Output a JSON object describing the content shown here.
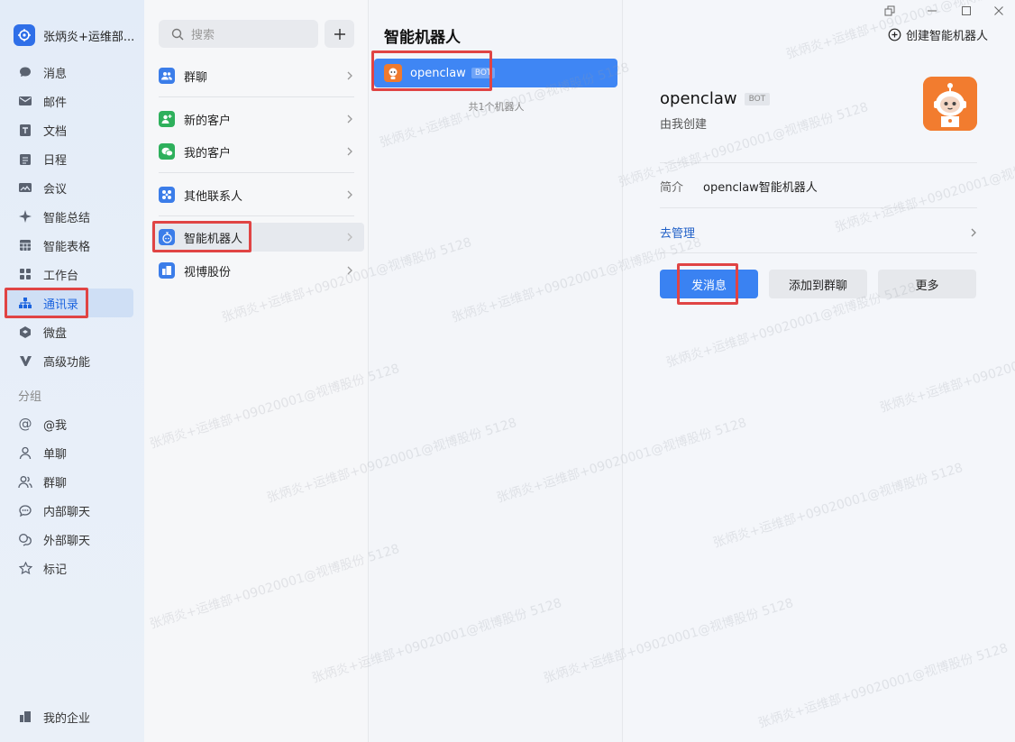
{
  "nav": {
    "enterprise_name": "张炳炎+运维部...",
    "items": [
      {
        "label": "消息",
        "icon": "chat-icon"
      },
      {
        "label": "邮件",
        "icon": "mail-icon"
      },
      {
        "label": "文档",
        "icon": "doc-icon"
      },
      {
        "label": "日程",
        "icon": "calendar-icon"
      },
      {
        "label": "会议",
        "icon": "meeting-icon"
      },
      {
        "label": "智能总结",
        "icon": "sparkle-icon"
      },
      {
        "label": "智能表格",
        "icon": "table-icon"
      },
      {
        "label": "工作台",
        "icon": "grid-icon"
      },
      {
        "label": "通讯录",
        "icon": "org-chart-icon",
        "active": true
      },
      {
        "label": "微盘",
        "icon": "drive-icon"
      },
      {
        "label": "高级功能",
        "icon": "v-icon"
      }
    ],
    "section_label": "分组",
    "groups": [
      {
        "label": "@我",
        "icon": "at-icon"
      },
      {
        "label": "单聊",
        "icon": "person-icon"
      },
      {
        "label": "群聊",
        "icon": "people-icon"
      },
      {
        "label": "内部聊天",
        "icon": "bubble-icon"
      },
      {
        "label": "外部聊天",
        "icon": "bubbles-icon"
      },
      {
        "label": "标记",
        "icon": "star-icon"
      }
    ],
    "bottom_label": "我的企业"
  },
  "contacts": {
    "search_placeholder": "搜索",
    "items": [
      {
        "label": "群聊",
        "color": "#3b7de9"
      },
      {
        "label": "新的客户",
        "color": "#2eb05c"
      },
      {
        "label": "我的客户",
        "color": "#2eb05c"
      },
      {
        "label": "其他联系人",
        "color": "#3b7de9"
      },
      {
        "label": "智能机器人",
        "color": "#3b7de9",
        "active": true
      },
      {
        "label": "视博股份",
        "color": "#3b7de9"
      }
    ]
  },
  "botlist": {
    "title": "智能机器人",
    "bot_name": "openclaw",
    "bot_tag": "BOT",
    "count_text": "共1个机器人"
  },
  "detail": {
    "create_label": "创建智能机器人",
    "name": "openclaw",
    "tag": "BOT",
    "creator": "由我创建",
    "intro_label": "简介",
    "intro_value": "openclaw智能机器人",
    "manage_label": "去管理",
    "send_button": "发消息",
    "add_group_button": "添加到群聊",
    "more_button": "更多"
  },
  "watermark": "张炳炎+运维部+09020001@视博股份 5128",
  "colors": {
    "accent": "#3a82f2",
    "annotation": "#e04444",
    "bot_avatar": "#f27c2f"
  }
}
